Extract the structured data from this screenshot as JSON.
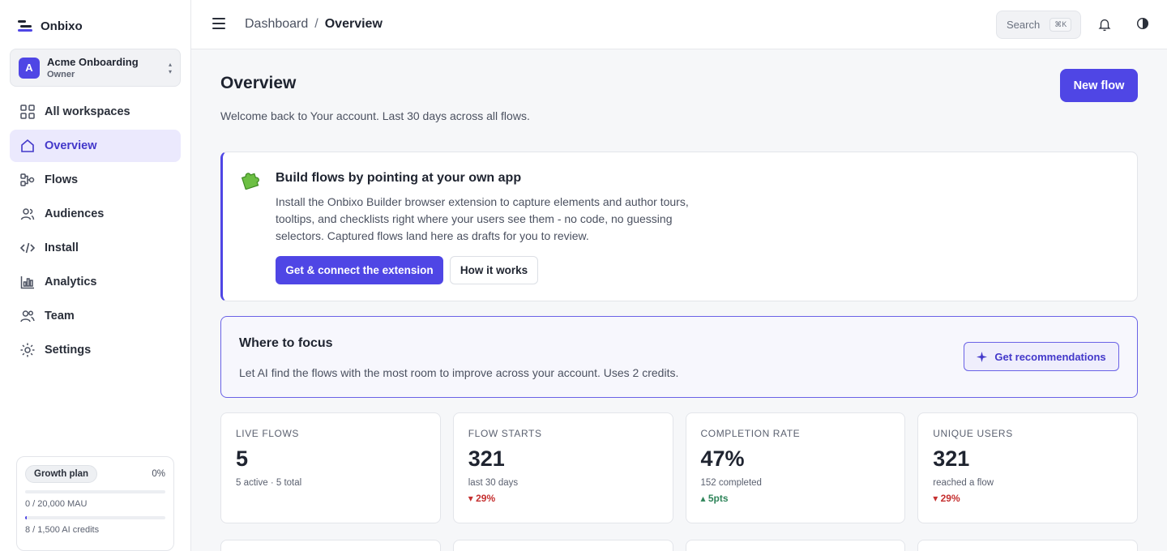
{
  "brand": {
    "name": "Onbixo"
  },
  "workspace": {
    "initial": "A",
    "name": "Acme Onboarding",
    "role": "Owner"
  },
  "sidebar": {
    "items": [
      {
        "label": "All workspaces",
        "icon": "grid-icon"
      },
      {
        "label": "Overview",
        "icon": "home-icon",
        "active": true
      },
      {
        "label": "Flows",
        "icon": "flows-icon"
      },
      {
        "label": "Audiences",
        "icon": "users-icon"
      },
      {
        "label": "Install",
        "icon": "code-icon"
      },
      {
        "label": "Analytics",
        "icon": "bar-chart-icon"
      },
      {
        "label": "Team",
        "icon": "team-icon"
      },
      {
        "label": "Settings",
        "icon": "gear-icon"
      }
    ]
  },
  "plan": {
    "badge": "Growth plan",
    "percent_label": "0%",
    "mau_label": "0 / 20,000 MAU",
    "mau_fraction": 0.0,
    "credits_label": "8 / 1,500 AI credits",
    "credits_fraction": 0.0053
  },
  "topbar": {
    "breadcrumb_parent": "Dashboard",
    "breadcrumb_sep": "/",
    "breadcrumb_current": "Overview",
    "search_label": "Search",
    "search_shortcut": "⌘K"
  },
  "main": {
    "title": "Overview",
    "subtitle": "Welcome back to Your account. Last 30 days across all flows.",
    "new_flow_label": "New flow"
  },
  "extension_card": {
    "title": "Build flows by pointing at your own app",
    "body": "Install the Onbixo Builder browser extension to capture elements and author tours, tooltips, and checklists right where your users see them - no code, no guessing selectors. Captured flows land here as drafts for you to review.",
    "primary_label": "Get & connect the extension",
    "secondary_label": "How it works"
  },
  "focus_card": {
    "title": "Where to focus",
    "body": "Let AI find the flows with the most room to improve across your account. Uses 2 credits.",
    "button_label": "Get recommendations"
  },
  "stats": [
    {
      "label": "LIVE FLOWS",
      "value": "5",
      "meta": "5 active · 5 total",
      "delta": "",
      "direction": ""
    },
    {
      "label": "FLOW STARTS",
      "value": "321",
      "meta": "last 30 days",
      "delta": "▾ 29%",
      "direction": "down"
    },
    {
      "label": "COMPLETION RATE",
      "value": "47%",
      "meta": "152 completed",
      "delta": "▴ 5pts",
      "direction": "up"
    },
    {
      "label": "UNIQUE USERS",
      "value": "321",
      "meta": "reached a flow",
      "delta": "▾ 29%",
      "direction": "down"
    }
  ],
  "colors": {
    "accent": "#4f46e5",
    "down": "#c53030",
    "up": "#2f855a"
  }
}
